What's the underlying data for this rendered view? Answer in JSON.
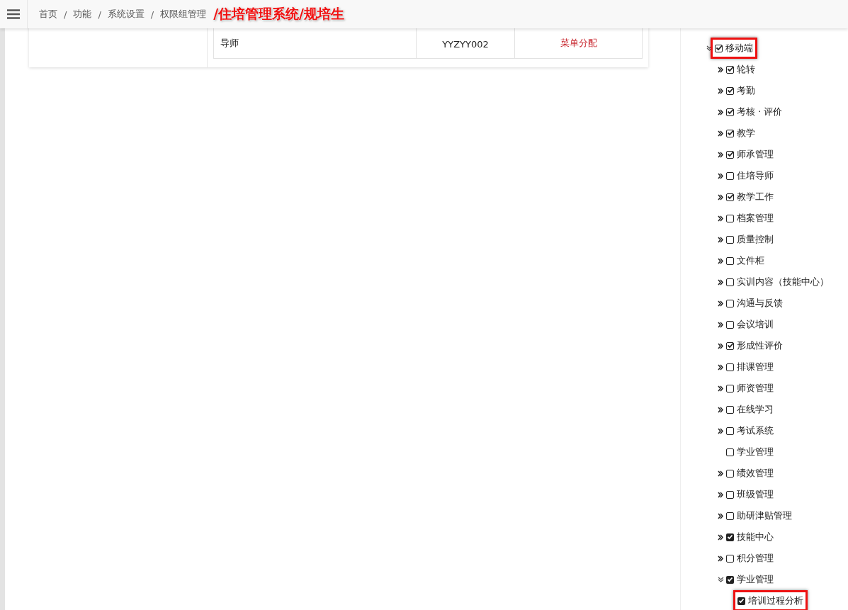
{
  "breadcrumbs": [
    "首页",
    "功能",
    "系统设置",
    "权限组管理"
  ],
  "breadcrumb_separator": "/",
  "annotation": "/住培管理系统/规培生",
  "table": {
    "rows": [
      {
        "cells": [
          "导师",
          "YYZYY002"
        ],
        "action": "菜单分配"
      }
    ]
  },
  "tree": [
    {
      "label": "移动端",
      "checked": true,
      "kind": "plain",
      "expanded": true,
      "highlighted": true,
      "children": [
        {
          "label": "轮转",
          "checked": true,
          "kind": "plain",
          "expanded": false,
          "highlighted": false
        },
        {
          "label": "考勤",
          "checked": true,
          "kind": "plain",
          "expanded": false,
          "highlighted": false
        },
        {
          "label": "考核 · 评价",
          "checked": true,
          "kind": "plain",
          "expanded": false,
          "highlighted": false
        },
        {
          "label": "教学",
          "checked": true,
          "kind": "plain",
          "expanded": false,
          "highlighted": false
        },
        {
          "label": "师承管理",
          "checked": true,
          "kind": "plain",
          "expanded": false,
          "highlighted": false
        },
        {
          "label": "住培导师",
          "checked": false,
          "kind": "plain",
          "expanded": false,
          "highlighted": false
        },
        {
          "label": "教学工作",
          "checked": true,
          "kind": "plain",
          "expanded": false,
          "highlighted": false
        },
        {
          "label": "档案管理",
          "checked": false,
          "kind": "plain",
          "expanded": false,
          "highlighted": false
        },
        {
          "label": "质量控制",
          "checked": false,
          "kind": "plain",
          "expanded": false,
          "highlighted": false
        },
        {
          "label": "文件柜",
          "checked": false,
          "kind": "plain",
          "expanded": false,
          "highlighted": false
        },
        {
          "label": "实训内容（技能中心）",
          "checked": false,
          "kind": "plain",
          "expanded": false,
          "highlighted": false
        },
        {
          "label": "沟通与反馈",
          "checked": false,
          "kind": "plain",
          "expanded": false,
          "highlighted": false
        },
        {
          "label": "会议培训",
          "checked": false,
          "kind": "plain",
          "expanded": false,
          "highlighted": false
        },
        {
          "label": "形成性评价",
          "checked": true,
          "kind": "plain",
          "expanded": false,
          "highlighted": false
        },
        {
          "label": "排课管理",
          "checked": false,
          "kind": "plain",
          "expanded": false,
          "highlighted": false
        },
        {
          "label": "师资管理",
          "checked": false,
          "kind": "plain",
          "expanded": false,
          "highlighted": false
        },
        {
          "label": "在线学习",
          "checked": false,
          "kind": "plain",
          "expanded": false,
          "highlighted": false
        },
        {
          "label": "考试系统",
          "checked": false,
          "kind": "plain",
          "expanded": false,
          "highlighted": false
        },
        {
          "label": "学业管理",
          "checked": false,
          "kind": "plain",
          "highlighted": false
        },
        {
          "label": "绩效管理",
          "checked": false,
          "kind": "plain",
          "expanded": false,
          "highlighted": false
        },
        {
          "label": "班级管理",
          "checked": false,
          "kind": "plain",
          "expanded": false,
          "highlighted": false
        },
        {
          "label": "助研津贴管理",
          "checked": false,
          "kind": "plain",
          "expanded": false,
          "highlighted": false
        },
        {
          "label": "技能中心",
          "checked": true,
          "kind": "solid",
          "expanded": false,
          "highlighted": false
        },
        {
          "label": "积分管理",
          "checked": false,
          "kind": "plain",
          "expanded": false,
          "highlighted": false
        },
        {
          "label": "学业管理",
          "checked": true,
          "kind": "solid",
          "expanded": true,
          "highlighted": false,
          "children": [
            {
              "label": "培训过程分析",
              "checked": true,
              "kind": "solid",
              "highlighted": true
            }
          ]
        }
      ]
    }
  ]
}
